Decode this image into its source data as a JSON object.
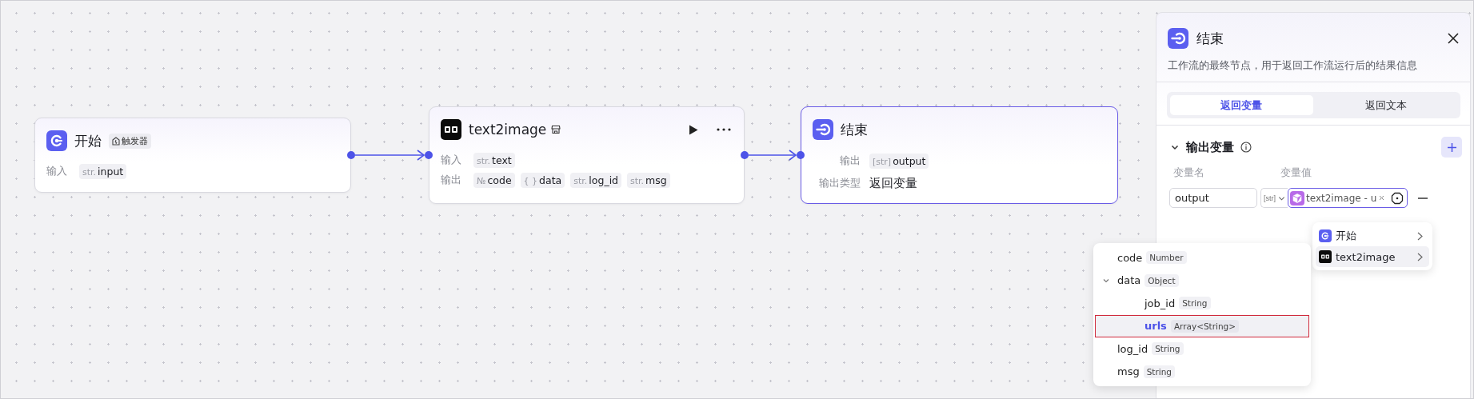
{
  "nodes": [
    {
      "kind": "start",
      "title": "开始",
      "badge": "触发器",
      "selected": false,
      "rows": [
        {
          "label": "输入",
          "tags": [
            {
              "type": "str.",
              "name": "input"
            }
          ]
        }
      ]
    },
    {
      "kind": "plugin",
      "title": "text2image",
      "selected": false,
      "rows": [
        {
          "label": "输入",
          "tags": [
            {
              "type": "str.",
              "name": "text"
            }
          ]
        },
        {
          "label": "输出",
          "tags": [
            {
              "type": "№",
              "name": "code"
            },
            {
              "type": "{ }",
              "name": "data"
            },
            {
              "type": "str.",
              "name": "log_id"
            },
            {
              "type": "str.",
              "name": "msg"
            }
          ]
        }
      ]
    },
    {
      "kind": "end",
      "title": "结束",
      "selected": true,
      "rows": [
        {
          "label": "输出",
          "tags": [
            {
              "type": "[str]",
              "name": "output"
            }
          ]
        },
        {
          "label": "输出类型",
          "value": "返回变量"
        }
      ]
    }
  ],
  "panel": {
    "title": "结束",
    "description": "工作流的最终节点，用于返回工作流运行后的结果信息",
    "tabs": [
      {
        "label": "返回变量",
        "selected": true
      },
      {
        "label": "返回文本",
        "selected": false
      }
    ],
    "section": {
      "title": "输出变量",
      "expanded": true,
      "columns": [
        "变量名",
        "变量值"
      ],
      "variables": [
        {
          "name": "output",
          "type": "[str]",
          "reference": "text2image - u"
        }
      ]
    },
    "node_menu": [
      {
        "label": "开始",
        "kind": "start",
        "selected": false
      },
      {
        "label": "text2image",
        "kind": "plugin",
        "selected": true
      }
    ],
    "field_menu": [
      {
        "name": "code",
        "type": "Number",
        "selected": false
      },
      {
        "name": "data",
        "type": "Object",
        "selected": false,
        "expanded": true,
        "children": [
          {
            "name": "job_id",
            "type": "String",
            "selected": false
          },
          {
            "name": "urls",
            "type": "Array<String>",
            "selected": true
          }
        ]
      },
      {
        "name": "log_id",
        "type": "String",
        "selected": false
      },
      {
        "name": "msg",
        "type": "String",
        "selected": false
      }
    ]
  }
}
